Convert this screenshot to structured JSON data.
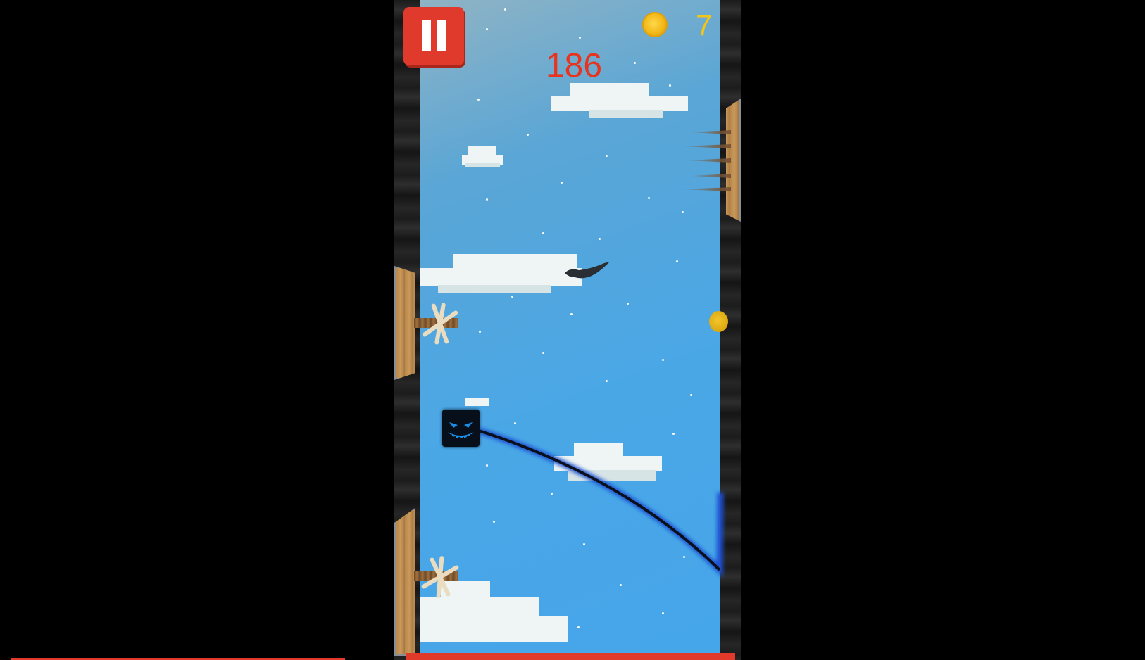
{
  "hud": {
    "pause_icon": "pause-icon",
    "score": "186",
    "coin_icon": "coin-icon",
    "coin_count": "7"
  },
  "colors": {
    "score": "#e8341f",
    "coins": "#f2c518",
    "pause_button": "#e03a2c",
    "sky": "#4aa7e6",
    "trail": "#1a4fd0"
  },
  "scene": {
    "player": "monster-icon",
    "hazards": [
      "spike-trap-icon",
      "spinning-blade-icon",
      "spinning-blade-icon"
    ],
    "enemy": "bird-icon",
    "pickup": "coin-icon"
  }
}
